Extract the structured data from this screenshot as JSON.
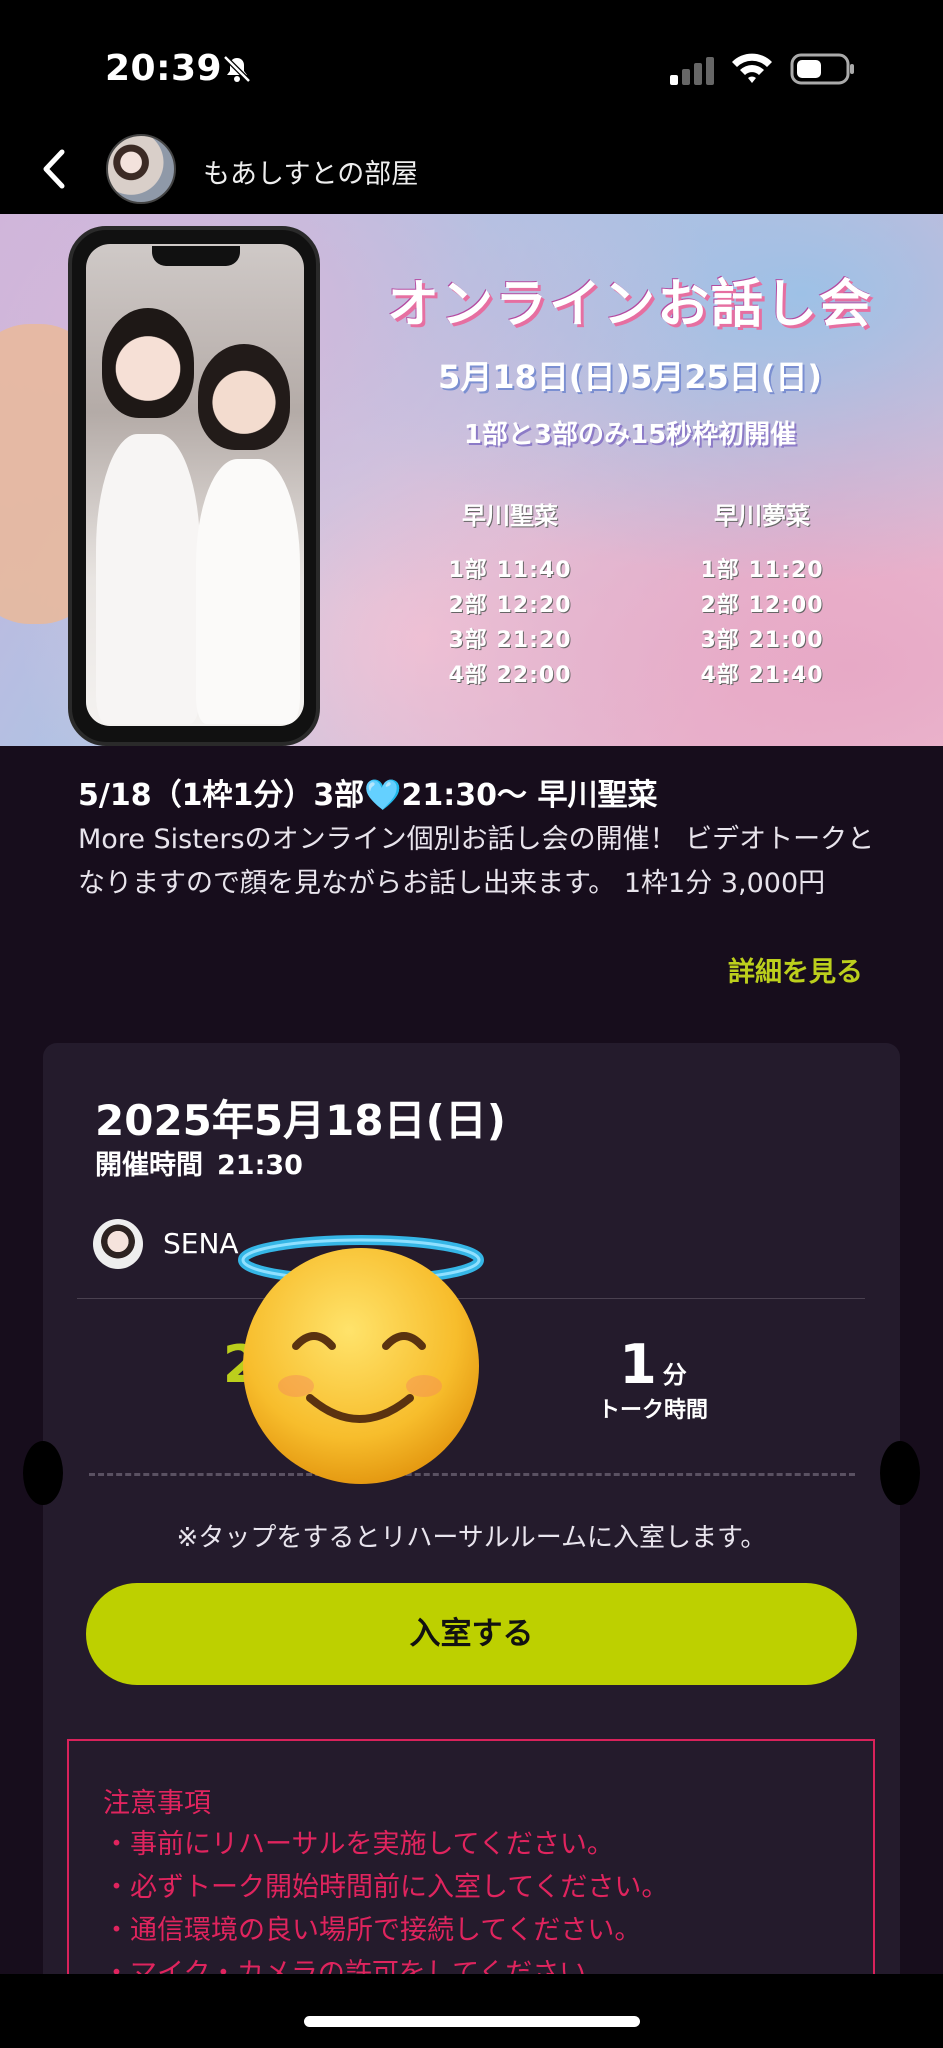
{
  "status_bar": {
    "time": "20:39",
    "icons": [
      "bell-slash-icon",
      "cellular-signal-icon",
      "wifi-icon",
      "battery-icon"
    ]
  },
  "header": {
    "back_icon": "chevron-left-icon",
    "room_name": "もあしすとの部屋"
  },
  "banner": {
    "title": "オンラインお話し会",
    "dates": "5月18日(日)5月25日(日)",
    "note": "1部と3部のみ15秒枠初開催",
    "schedules": [
      {
        "name": "早川聖菜",
        "rows": [
          "1部 11:40",
          "2部 12:20",
          "3部 21:20",
          "4部 22:00"
        ]
      },
      {
        "name": "早川夢菜",
        "rows": [
          "1部 11:20",
          "2部 12:00",
          "3部 21:00",
          "4部 21:40"
        ]
      }
    ]
  },
  "event": {
    "title": "5/18（1枠1分）3部🩵21:30〜 早川聖菜",
    "description": "More Sistersのオンライン個別お話し会の開催！ ビデオトークとなりますので顔を見ながらお話し出来ます。 1枠1分 3,000円",
    "detail_link": "詳細を見る"
  },
  "ticket": {
    "date": "2025年5月18日(日)",
    "time_label": "開催時間",
    "time_value": "21:30",
    "host_name": "SENA",
    "stat_left_partial": "2",
    "talk_minutes": "1",
    "talk_unit": "分",
    "talk_label": "トーク時間",
    "tap_note": "※タップをするとリハーサルルームに入室します。",
    "enter_button": "入室する"
  },
  "caution": {
    "title": "注意事項",
    "items": [
      "・事前にリハーサルを実施してください。",
      "・必ずトーク開始時間前に入室してください。",
      "・通信環境の良い場所で接続してください。",
      "・マイク・カメラの許可をしてください。"
    ]
  },
  "overlay": {
    "emoji": "smiling-face-with-halo-icon"
  },
  "colors": {
    "accent": "#bdd000",
    "caution": "#e0245e",
    "background": "#170d1c",
    "card": "#241b2c"
  }
}
